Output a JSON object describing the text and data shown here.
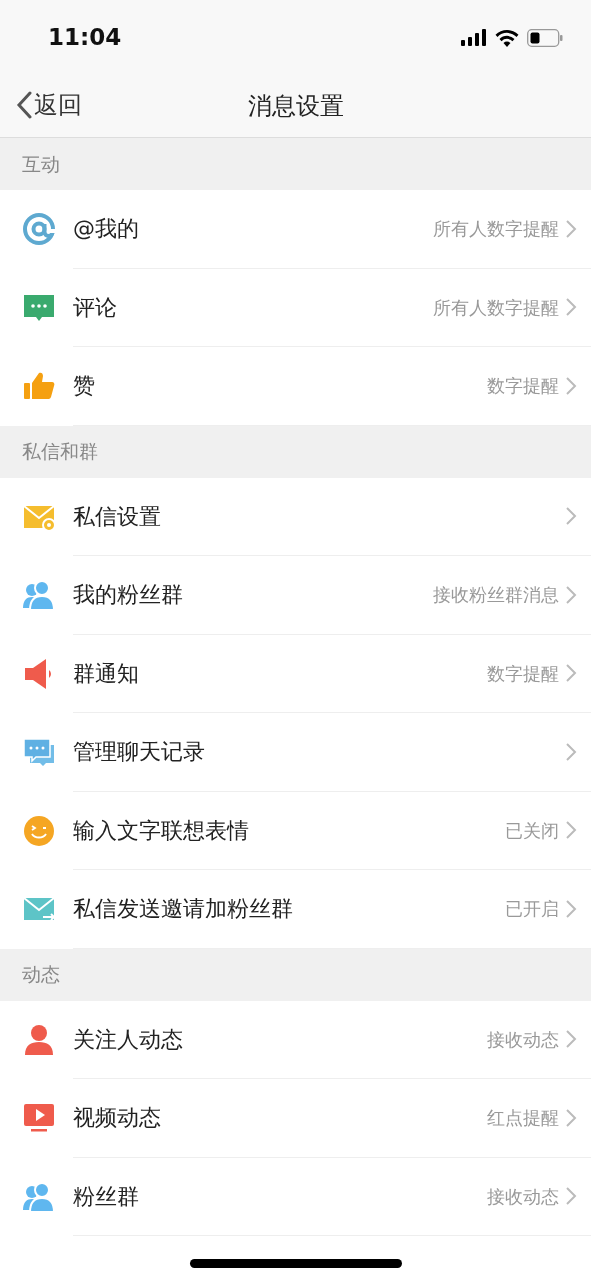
{
  "status_bar": {
    "time": "11:04"
  },
  "nav": {
    "back": "返回",
    "title": "消息设置"
  },
  "sections": [
    {
      "title": "互动",
      "rows": [
        {
          "label": "@我的",
          "value": "所有人数字提醒"
        },
        {
          "label": "评论",
          "value": "所有人数字提醒"
        },
        {
          "label": "赞",
          "value": "数字提醒"
        }
      ]
    },
    {
      "title": "私信和群",
      "rows": [
        {
          "label": "私信设置"
        },
        {
          "label": "我的粉丝群",
          "value": "接收粉丝群消息"
        },
        {
          "label": "群通知",
          "value": "数字提醒"
        },
        {
          "label": "管理聊天记录"
        },
        {
          "label": "输入文字联想表情",
          "value": "已关闭"
        },
        {
          "label": "私信发送邀请加粉丝群",
          "value": "已开启"
        }
      ]
    },
    {
      "title": "动态",
      "rows": [
        {
          "label": "关注人动态",
          "value": "接收动态"
        },
        {
          "label": "视频动态",
          "value": "红点提醒"
        },
        {
          "label": "粉丝群",
          "value": "接收动态"
        }
      ]
    }
  ]
}
